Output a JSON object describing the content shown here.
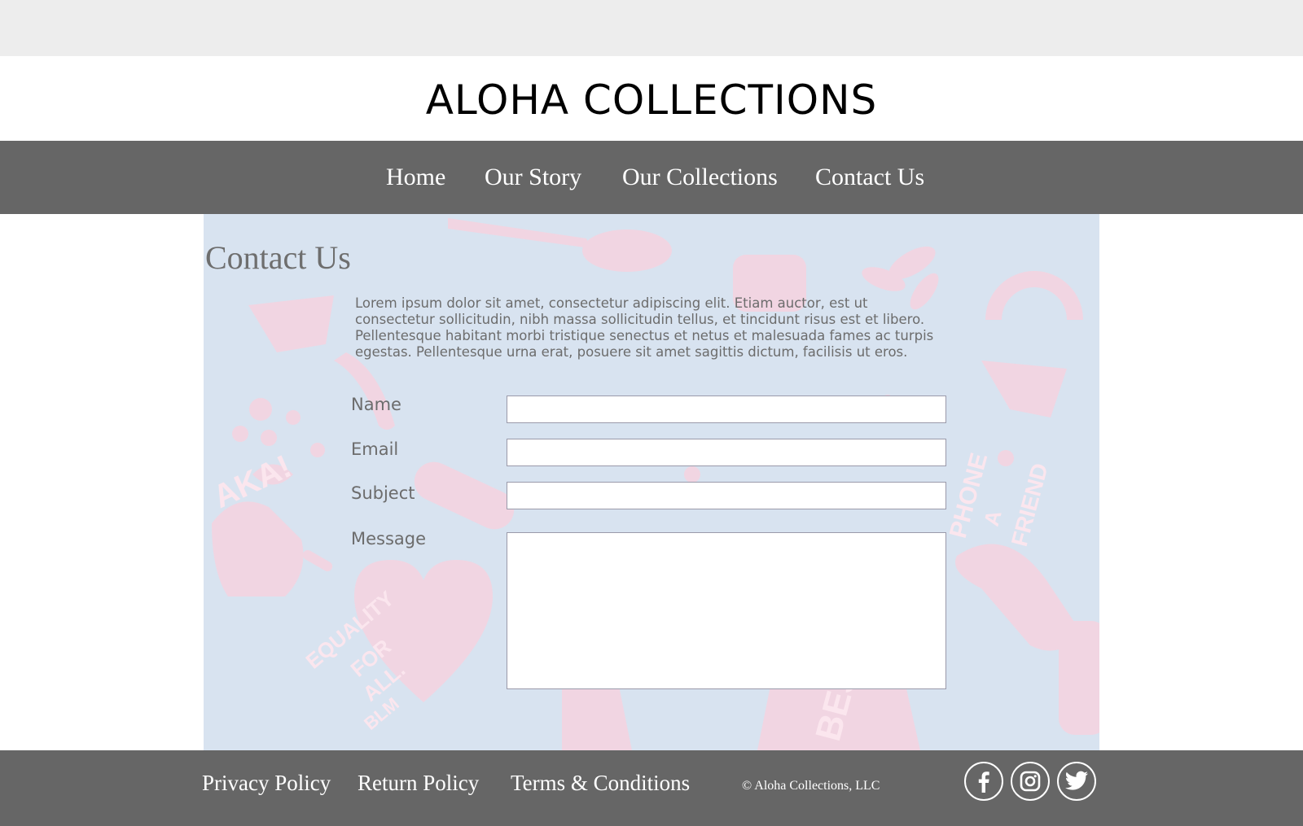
{
  "site": {
    "title": "ALOHA COLLECTIONS"
  },
  "nav": {
    "items": [
      "Home",
      "Our Story",
      "Our Collections",
      "Contact Us"
    ]
  },
  "contact": {
    "heading": "Contact Us",
    "intro": "Lorem ipsum dolor sit amet, consectetur adipiscing elit. Etiam auctor, est ut consectetur sollicitudin, nibh massa sollicitudin tellus, et tincidunt risus est et libero. Pellentesque habitant morbi tristique senectus et netus et malesuada fames ac turpis egestas. Pellentesque urna erat, posuere sit amet sagittis dictum, facilisis ut eros.",
    "fields": {
      "name_label": "Name",
      "name_value": "",
      "email_label": "Email",
      "email_value": "",
      "subject_label": "Subject",
      "subject_value": "",
      "message_label": "Message",
      "message_value": ""
    },
    "background_text": [
      "AKA!",
      "EQUALITY",
      "FOR",
      "ALL.",
      "BLM",
      "PHONE",
      "A",
      "FRIEND",
      "BEST"
    ]
  },
  "footer": {
    "links": [
      "Privacy Policy",
      "Return Policy",
      "Terms & Conditions"
    ],
    "copyright": "© Aloha Collections, LLC",
    "social": [
      "facebook-icon",
      "instagram-icon",
      "twitter-icon"
    ]
  },
  "colors": {
    "nav_bg": "#666666",
    "top_strip": "#ededed",
    "content_bg": "#d8e3f0",
    "pattern_pink": "#f6d3df",
    "heading_text": "#6e6e6e",
    "body_text": "#6c6c6c"
  }
}
